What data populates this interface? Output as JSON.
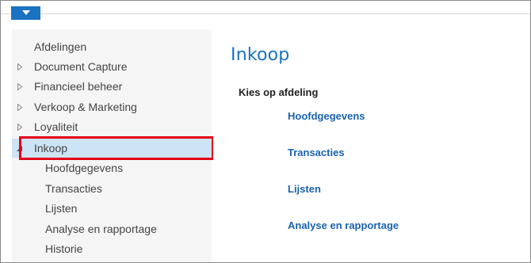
{
  "header": {
    "menu_icon": "chevron-down-icon",
    "accent_color": "#1a72c2"
  },
  "sidebar": {
    "items": [
      {
        "label": "Afdelingen",
        "level": 0,
        "arrow": "none"
      },
      {
        "label": "Document Capture",
        "level": 0,
        "arrow": "collapsed"
      },
      {
        "label": "Financieel beheer",
        "level": 0,
        "arrow": "collapsed"
      },
      {
        "label": "Verkoop & Marketing",
        "level": 0,
        "arrow": "collapsed"
      },
      {
        "label": "Loyaliteit",
        "level": 0,
        "arrow": "collapsed"
      },
      {
        "label": "Inkoop",
        "level": 0,
        "arrow": "expanded",
        "selected": true
      },
      {
        "label": "Hoofdgegevens",
        "level": 1
      },
      {
        "label": "Transacties",
        "level": 1
      },
      {
        "label": "Lijsten",
        "level": 1
      },
      {
        "label": "Analyse en rapportage",
        "level": 1
      },
      {
        "label": "Historie",
        "level": 1
      }
    ],
    "selected_bg_color": "#cde3f6",
    "highlight_border_color": "#e4001b"
  },
  "main": {
    "title": "Inkoop",
    "section_label": "Kies op afdeling",
    "links": [
      {
        "label": "Hoofdgegevens"
      },
      {
        "label": "Transacties"
      },
      {
        "label": "Lijsten"
      },
      {
        "label": "Analyse en rapportage"
      }
    ]
  }
}
